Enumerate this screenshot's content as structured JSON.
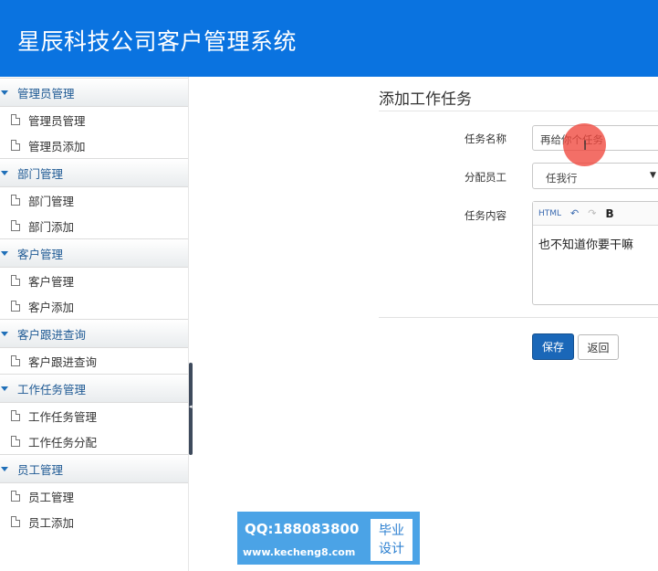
{
  "header": {
    "title": "星辰科技公司客户管理系统",
    "bg_color": "#0a73e0"
  },
  "sidebar": {
    "groups": [
      {
        "label": "管理员管理",
        "items": [
          "管理员管理",
          "管理员添加"
        ]
      },
      {
        "label": "部门管理",
        "items": [
          "部门管理",
          "部门添加"
        ]
      },
      {
        "label": "客户管理",
        "items": [
          "客户管理",
          "客户添加"
        ]
      },
      {
        "label": "客户跟进查询",
        "items": [
          "客户跟进查询"
        ]
      },
      {
        "label": "工作任务管理",
        "items": [
          "工作任务管理",
          "工作任务分配"
        ]
      },
      {
        "label": "员工管理",
        "items": [
          "员工管理",
          "员工添加"
        ]
      }
    ]
  },
  "form": {
    "title": "添加工作任务",
    "task_name_label": "任务名称",
    "task_name_value": "再给你个任务",
    "assign_label": "分配员工",
    "assign_value": "任我行",
    "content_label": "任务内容",
    "content_value": "也不知道你要干嘛",
    "toolbar": {
      "html": "HTML",
      "undo_icon": "undo-icon",
      "redo_icon": "redo-icon",
      "bold": "B"
    },
    "save_label": "保存",
    "back_label": "返回",
    "save_color": "#1a67b8"
  },
  "watermark": {
    "qq": "QQ:188083800",
    "url": "www.kecheng8.com",
    "badge_line1": "毕业",
    "badge_line2": "设计"
  }
}
